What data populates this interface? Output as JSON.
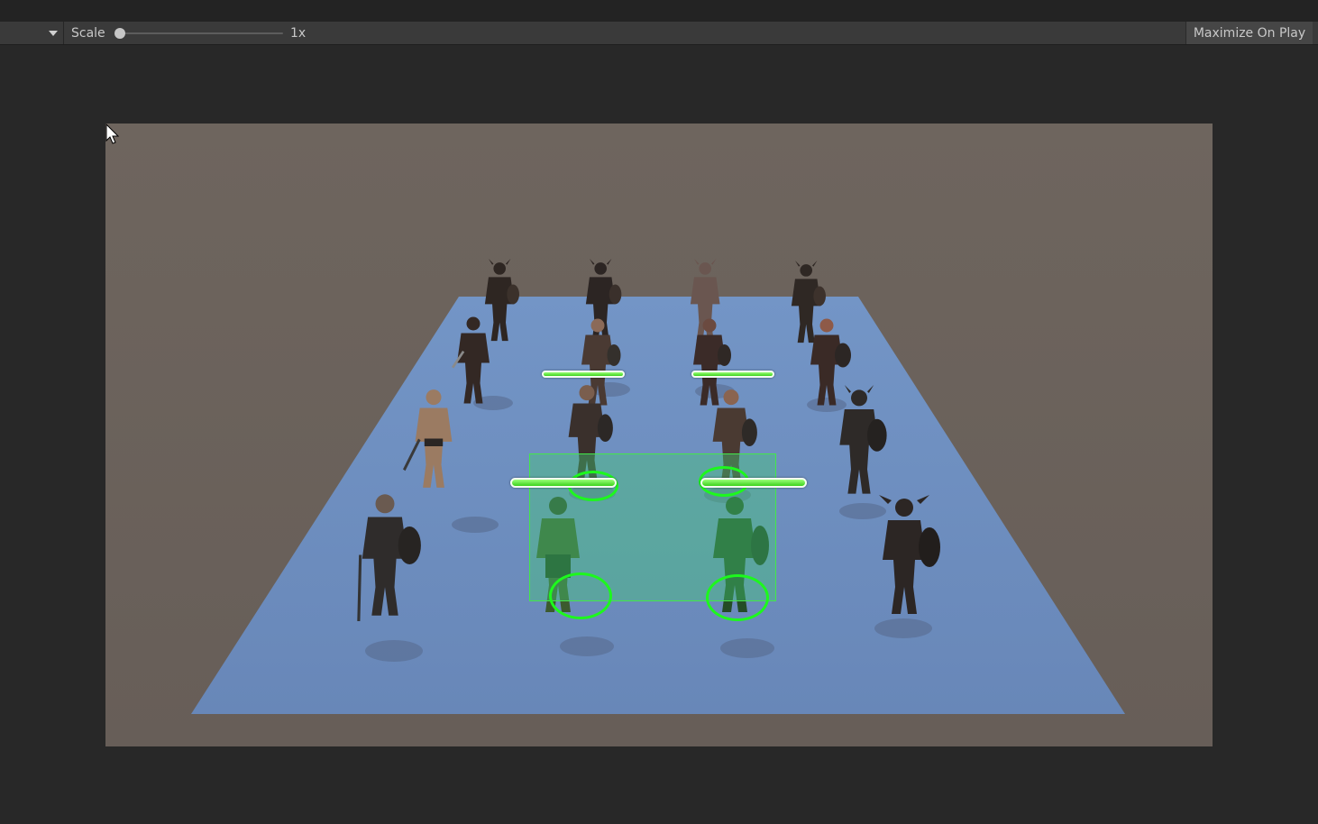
{
  "toolbar": {
    "scale_label": "Scale",
    "scale_value": "1x",
    "maximize_label": "Maximize On Play"
  },
  "scene": {
    "background_color": "#6b625b",
    "ground_color": "#6f8fbd",
    "selection_color": "#43e84a",
    "units_total": 15,
    "selected_units": 2,
    "health_bars": [
      {
        "id": "hb-1",
        "fill": 1.0
      },
      {
        "id": "hb-2",
        "fill": 1.0
      },
      {
        "id": "hb-3",
        "fill": 1.0
      },
      {
        "id": "hb-4",
        "fill": 1.0
      }
    ]
  },
  "icons": {
    "dropdown": "chevron-down-icon",
    "cursor": "mouse-pointer-icon"
  }
}
